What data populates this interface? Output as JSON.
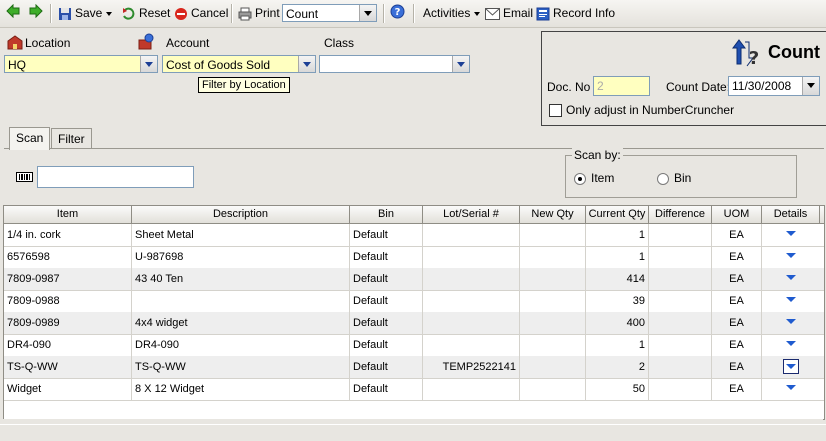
{
  "toolbar": {
    "save": "Save",
    "reset": "Reset",
    "cancel": "Cancel",
    "print": "Print",
    "print_format": "Count",
    "activities": "Activities",
    "email": "Email",
    "record_info": "Record Info"
  },
  "form": {
    "location_label": "Location",
    "location_value": "HQ",
    "account_label": "Account",
    "account_value": "Cost of Goods Sold",
    "class_label": "Class",
    "class_value": "",
    "tooltip": "Filter by Location"
  },
  "count_panel": {
    "title": "Count",
    "doc_no_label": "Doc. No",
    "doc_no_value": "2",
    "count_date_label": "Count Date:",
    "count_date_value": "11/30/2008",
    "only_adjust_label": "Only adjust in NumberCruncher"
  },
  "tabs": [
    "Scan",
    "Filter"
  ],
  "scan": {
    "scan_value": "",
    "scan_by_label": "Scan by:",
    "option_item": "Item",
    "option_bin": "Bin"
  },
  "grid": {
    "columns": [
      "Item",
      "Description",
      "Bin",
      "Lot/Serial #",
      "New Qty",
      "Current Qty",
      "Difference",
      "UOM",
      "Details"
    ],
    "rows": [
      {
        "item": "1/4 in. cork",
        "description": "Sheet Metal",
        "bin": "Default",
        "lot": "",
        "new_qty": "",
        "current_qty": "1",
        "difference": "",
        "uom": "EA"
      },
      {
        "item": "6576598",
        "description": "U-987698",
        "bin": "Default",
        "lot": "",
        "new_qty": "",
        "current_qty": "1",
        "difference": "",
        "uom": "EA"
      },
      {
        "item": "7809-0987",
        "description": "43 40 Ten",
        "bin": "Default",
        "lot": "",
        "new_qty": "",
        "current_qty": "414",
        "difference": "",
        "uom": "EA"
      },
      {
        "item": "7809-0988",
        "description": "",
        "bin": "Default",
        "lot": "",
        "new_qty": "",
        "current_qty": "39",
        "difference": "",
        "uom": "EA"
      },
      {
        "item": "7809-0989",
        "description": "4x4 widget",
        "bin": "Default",
        "lot": "",
        "new_qty": "",
        "current_qty": "400",
        "difference": "",
        "uom": "EA"
      },
      {
        "item": "DR4-090",
        "description": "DR4-090",
        "bin": "Default",
        "lot": "",
        "new_qty": "",
        "current_qty": "1",
        "difference": "",
        "uom": "EA"
      },
      {
        "item": "TS-Q-WW",
        "description": "TS-Q-WW",
        "bin": "Default",
        "lot": "TEMP2522141",
        "new_qty": "",
        "current_qty": "2",
        "difference": "",
        "uom": "EA"
      },
      {
        "item": "Widget",
        "description": "8 X 12 Widget",
        "bin": "Default",
        "lot": "",
        "new_qty": "",
        "current_qty": "50",
        "difference": "",
        "uom": "EA"
      }
    ]
  },
  "colors": {
    "required_field": "#ffffc0",
    "detail_arrow": "#1f5bcf"
  }
}
